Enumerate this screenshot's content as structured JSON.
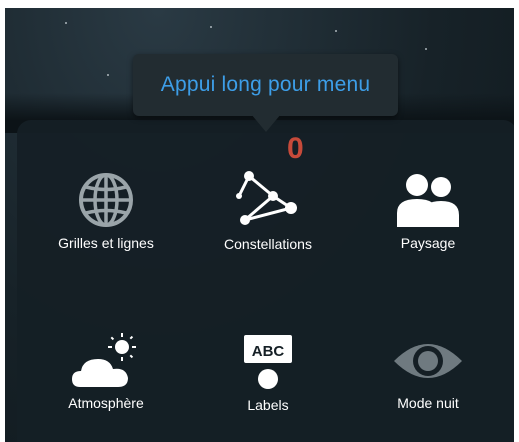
{
  "tooltip": {
    "text": "Appui long pour menu"
  },
  "badge": {
    "value": "0"
  },
  "menu": {
    "items": [
      {
        "label": "Grilles et lignes",
        "icon": "globe-grid-icon"
      },
      {
        "label": "Constellations",
        "icon": "constellation-icon"
      },
      {
        "label": "Paysage",
        "icon": "landscape-icon"
      },
      {
        "label": "Atmosphère",
        "icon": "atmosphere-cloud-sun-icon"
      },
      {
        "label": "Labels",
        "icon": "labels-abc-icon"
      },
      {
        "label": "Mode nuit",
        "icon": "night-mode-eye-icon"
      }
    ]
  },
  "colors": {
    "tooltip_text": "#3d9ee8",
    "badge": "#c64a3a",
    "panel": "#151f25"
  }
}
